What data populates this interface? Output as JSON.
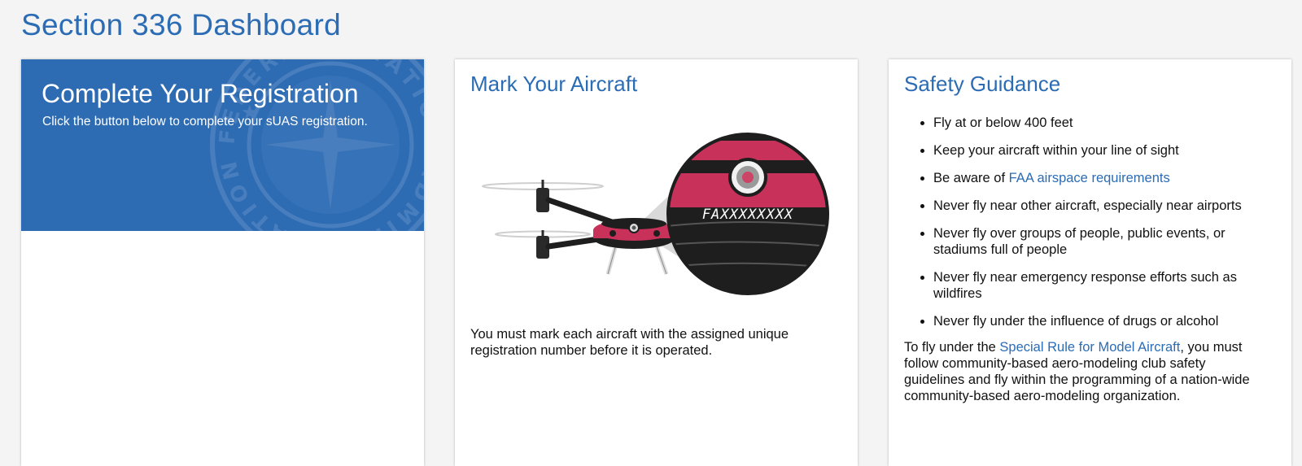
{
  "page": {
    "title": "Section 336 Dashboard"
  },
  "registration_card": {
    "title": "Complete Your Registration",
    "subtitle": "Click the button below to complete your sUAS registration.",
    "seal_text": "FEDERAL AVIATION ADMINISTRATION"
  },
  "mark_card": {
    "title": "Mark Your Aircraft",
    "registration_example": "FAXXXXXXXX",
    "description": "You must mark each aircraft with the assigned unique registration number before it is operated."
  },
  "safety_card": {
    "title": "Safety Guidance",
    "items": [
      {
        "text": "Fly at or below 400 feet"
      },
      {
        "text": "Keep your aircraft within your line of sight"
      },
      {
        "text_before": "Be aware of ",
        "link": "FAA airspace requirements"
      },
      {
        "text": "Never fly near other aircraft, especially near airports"
      },
      {
        "text": "Never fly over groups of people, public events, or stadiums full of people"
      },
      {
        "text": "Never fly near emergency response efforts such as wildfires"
      },
      {
        "text": "Never fly under the influence of drugs or alcohol"
      }
    ],
    "footer": {
      "before": "To fly under the ",
      "link": "Special Rule for Model Aircraft",
      "after": ", you must follow community-based aero-modeling club safety guidelines and fly within the programming of a nation-wide community-based aero-modeling organization."
    }
  },
  "colors": {
    "accent": "#2b6cb5",
    "banner": "#2d6bb3",
    "drone_red": "#c8325a",
    "drone_dark": "#1e1e1e"
  }
}
